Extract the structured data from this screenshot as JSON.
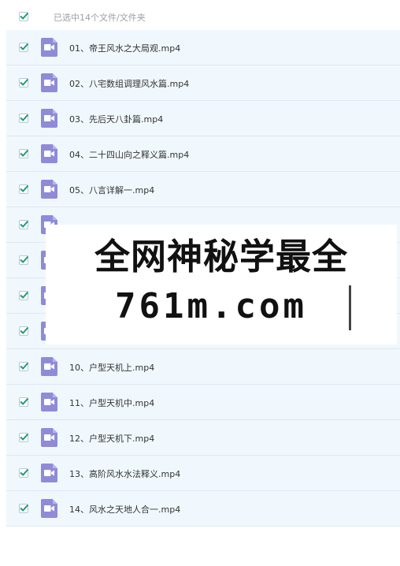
{
  "header": {
    "selection_text": "已选中14个文件/文件夹",
    "select_all_checked": true
  },
  "files": [
    {
      "name": "01、帝王风水之大局观.mp4",
      "checked": true
    },
    {
      "name": "02、八宅数组调理风水篇.mp4",
      "checked": true
    },
    {
      "name": "03、先后天八卦篇.mp4",
      "checked": true
    },
    {
      "name": "04、二十四山向之释义篇.mp4",
      "checked": true
    },
    {
      "name": "05、八言详解一.mp4",
      "checked": true
    },
    {
      "name": "",
      "checked": true
    },
    {
      "name": "",
      "checked": true
    },
    {
      "name": "",
      "checked": true
    },
    {
      "name": "",
      "checked": true
    },
    {
      "name": "10、户型天机上.mp4",
      "checked": true
    },
    {
      "name": "11、户型天机中.mp4",
      "checked": true
    },
    {
      "name": "12、户型天机下.mp4",
      "checked": true
    },
    {
      "name": "13、高阶风水水法释义.mp4",
      "checked": true
    },
    {
      "name": "14、风水之天地人合一.mp4",
      "checked": true
    }
  ],
  "watermark": {
    "line1": "全网神秘学最全",
    "line2": "761m.com"
  },
  "colors": {
    "row_bg": "#f1f8fd",
    "video_icon": "#8f8bd8",
    "check": "#1a9c79"
  },
  "icons": {
    "checkbox": "checkmark-icon",
    "file": "video-file-icon"
  }
}
